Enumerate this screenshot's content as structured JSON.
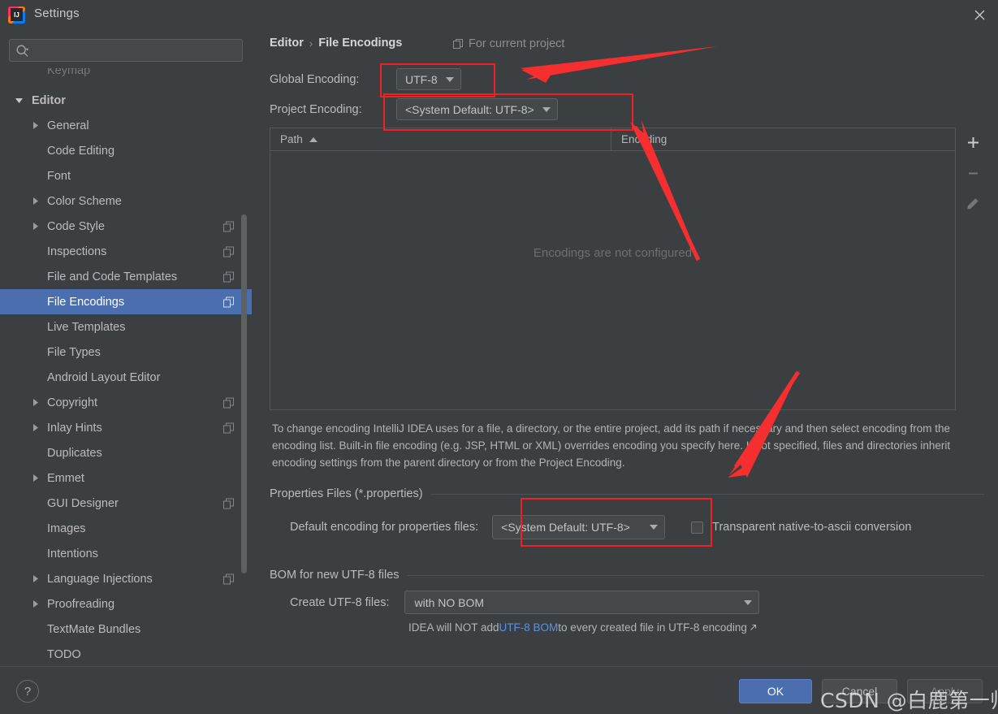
{
  "window": {
    "title": "Settings",
    "logo_text": "IJ",
    "close_icon": "close-icon"
  },
  "sidebar": {
    "search": {
      "placeholder": "",
      "value": "",
      "icon": "search-icon"
    },
    "partial_item_above": "Keymap",
    "items": [
      {
        "label": "Editor",
        "level": 0,
        "arrow": "down",
        "copy": false,
        "selected": false
      },
      {
        "label": "General",
        "level": 1,
        "arrow": "right",
        "copy": false,
        "selected": false
      },
      {
        "label": "Code Editing",
        "level": 1,
        "arrow": "none",
        "copy": false,
        "selected": false
      },
      {
        "label": "Font",
        "level": 1,
        "arrow": "none",
        "copy": false,
        "selected": false
      },
      {
        "label": "Color Scheme",
        "level": 1,
        "arrow": "right",
        "copy": false,
        "selected": false
      },
      {
        "label": "Code Style",
        "level": 1,
        "arrow": "right",
        "copy": true,
        "selected": false
      },
      {
        "label": "Inspections",
        "level": 1,
        "arrow": "none",
        "copy": true,
        "selected": false
      },
      {
        "label": "File and Code Templates",
        "level": 1,
        "arrow": "none",
        "copy": true,
        "selected": false
      },
      {
        "label": "File Encodings",
        "level": 1,
        "arrow": "none",
        "copy": true,
        "selected": true
      },
      {
        "label": "Live Templates",
        "level": 1,
        "arrow": "none",
        "copy": false,
        "selected": false
      },
      {
        "label": "File Types",
        "level": 1,
        "arrow": "none",
        "copy": false,
        "selected": false
      },
      {
        "label": "Android Layout Editor",
        "level": 1,
        "arrow": "none",
        "copy": false,
        "selected": false
      },
      {
        "label": "Copyright",
        "level": 1,
        "arrow": "right",
        "copy": true,
        "selected": false
      },
      {
        "label": "Inlay Hints",
        "level": 1,
        "arrow": "right",
        "copy": true,
        "selected": false
      },
      {
        "label": "Duplicates",
        "level": 1,
        "arrow": "none",
        "copy": false,
        "selected": false
      },
      {
        "label": "Emmet",
        "level": 1,
        "arrow": "right",
        "copy": false,
        "selected": false
      },
      {
        "label": "GUI Designer",
        "level": 1,
        "arrow": "none",
        "copy": true,
        "selected": false
      },
      {
        "label": "Images",
        "level": 1,
        "arrow": "none",
        "copy": false,
        "selected": false
      },
      {
        "label": "Intentions",
        "level": 1,
        "arrow": "none",
        "copy": false,
        "selected": false
      },
      {
        "label": "Language Injections",
        "level": 1,
        "arrow": "right",
        "copy": true,
        "selected": false
      },
      {
        "label": "Proofreading",
        "level": 1,
        "arrow": "right",
        "copy": false,
        "selected": false
      },
      {
        "label": "TextMate Bundles",
        "level": 1,
        "arrow": "none",
        "copy": false,
        "selected": false
      },
      {
        "label": "TODO",
        "level": 1,
        "arrow": "none",
        "copy": false,
        "selected": false
      }
    ]
  },
  "main": {
    "breadcrumb": {
      "parent": "Editor",
      "separator": "›",
      "current": "File Encodings"
    },
    "for_current_project": "For current project",
    "global_encoding": {
      "label": "Global Encoding:",
      "value": "UTF-8"
    },
    "project_encoding": {
      "label": "Project Encoding:",
      "value": "<System Default: UTF-8>"
    },
    "table": {
      "columns": [
        "Path",
        "Encoding"
      ],
      "sort_column": "Path",
      "sort_direction": "asc",
      "rows": [],
      "empty_message": "Encodings are not configured",
      "toolbar": [
        "add-icon",
        "remove-icon",
        "edit-icon"
      ]
    },
    "description": "To change encoding IntelliJ IDEA uses for a file, a directory, or the entire project, add its path if necessary and then select encoding from the encoding list. Built-in file encoding (e.g. JSP, HTML or XML) overrides encoding you specify here. If not specified, files and directories inherit encoding settings from the parent directory or from the Project Encoding.",
    "properties_group": {
      "title": "Properties Files (*.properties)",
      "default_encoding_label": "Default encoding for properties files:",
      "default_encoding_value": "<System Default: UTF-8>",
      "transparent_label": "Transparent native-to-ascii conversion",
      "transparent_checked": false
    },
    "bom_group": {
      "title": "BOM for new UTF-8 files",
      "create_label": "Create UTF-8 files:",
      "create_value": "with NO BOM",
      "hint_prefix": "IDEA will NOT add ",
      "hint_link": "UTF-8 BOM",
      "hint_suffix": " to every created file in UTF-8 encoding "
    }
  },
  "footer": {
    "help_label": "?",
    "ok_label": "OK",
    "cancel_label": "Cancel",
    "apply_label": "Apply"
  },
  "annotations": {
    "watermark": "CSDN @白鹿第一帅",
    "accent_red": "#ee2222",
    "accent_blue": "#4b6eaf",
    "link_blue": "#5c91e0"
  }
}
